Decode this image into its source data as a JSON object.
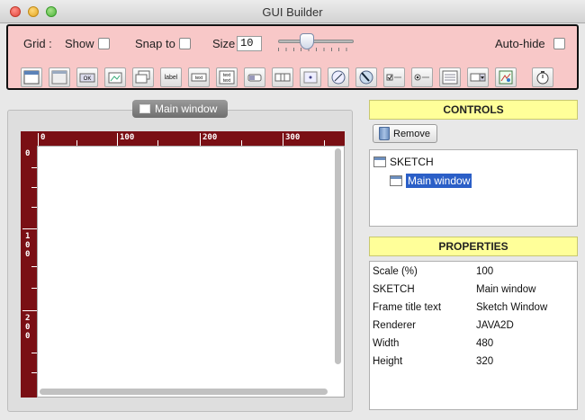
{
  "window": {
    "title": "GUI Builder"
  },
  "toolbar": {
    "grid_label": "Grid :",
    "show_label": "Show",
    "snap_label": "Snap to",
    "size_label": "Size",
    "size_value": "10",
    "slider_fraction": 0.33,
    "autohide_label": "Auto-hide",
    "accent_color": "#f8c8c8",
    "tools": [
      {
        "name": "window-tool-icon"
      },
      {
        "name": "panel-tool-icon"
      },
      {
        "name": "button-tool-icon",
        "text": "OK"
      },
      {
        "name": "image-button-tool-icon"
      },
      {
        "name": "image-toggle-tool-icon"
      },
      {
        "name": "label-tool-icon",
        "text": "label"
      },
      {
        "name": "textfield-tool-icon",
        "text": "text"
      },
      {
        "name": "textarea-tool-icon",
        "text": "text"
      },
      {
        "name": "toggle-button-tool-icon"
      },
      {
        "name": "spinner-tool-icon"
      },
      {
        "name": "sketchpad-tool-icon"
      },
      {
        "name": "knob-tool-icon"
      },
      {
        "name": "dial-tool-icon"
      },
      {
        "name": "checkbox-tool-icon"
      },
      {
        "name": "radio-tool-icon"
      },
      {
        "name": "list-tool-icon"
      },
      {
        "name": "dropdown-tool-icon"
      },
      {
        "name": "image-tool-icon"
      },
      {
        "name": "timer-tool-icon"
      }
    ]
  },
  "designer": {
    "tab_label": "Main window",
    "ruler_color": "#7a0f14",
    "ruler_top_labels": [
      "0",
      "100",
      "200",
      "300"
    ],
    "ruler_left_labels": [
      "0",
      "100",
      "200"
    ]
  },
  "controls": {
    "header": "CONTROLS",
    "remove_label": "Remove",
    "tree_root": "SKETCH",
    "tree_child": "Main window",
    "header_color": "#ffff99"
  },
  "properties": {
    "header": "PROPERTIES",
    "rows": [
      {
        "key": "Scale (%)",
        "value": "100"
      },
      {
        "key": "SKETCH",
        "value": "Main window"
      },
      {
        "key": "Frame title text",
        "value": "Sketch Window"
      },
      {
        "key": "Renderer",
        "value": "JAVA2D"
      },
      {
        "key": "Width",
        "value": "480"
      },
      {
        "key": "Height",
        "value": "320"
      }
    ]
  }
}
